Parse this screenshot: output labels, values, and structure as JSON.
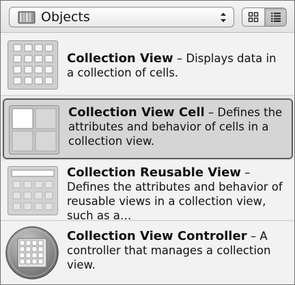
{
  "header": {
    "library_label": "Objects",
    "library_icon": "library-book-icon",
    "view_toggle": {
      "icon_view": "grid-icon",
      "list_view": "list-icon",
      "selected": "list"
    }
  },
  "items": [
    {
      "title": "Collection View",
      "separator": " – ",
      "description": "Displays data in a collection of cells.",
      "icon": "collection-view-icon",
      "selected": false
    },
    {
      "title": "Collection View Cell",
      "separator": " – ",
      "description": "Defines the attributes and behavior of cells in a collection view.",
      "icon": "collection-view-cell-icon",
      "selected": true
    },
    {
      "title": "Collection Reusable View",
      "separator": " – ",
      "description": "Defines the attributes and behavior of reusable views in a collection view, such as a…",
      "icon": "collection-reusable-view-icon",
      "selected": false
    },
    {
      "title": "Collection View Controller",
      "separator": " – ",
      "description": "A controller that manages a collection view.",
      "icon": "collection-view-controller-icon",
      "selected": false
    }
  ]
}
